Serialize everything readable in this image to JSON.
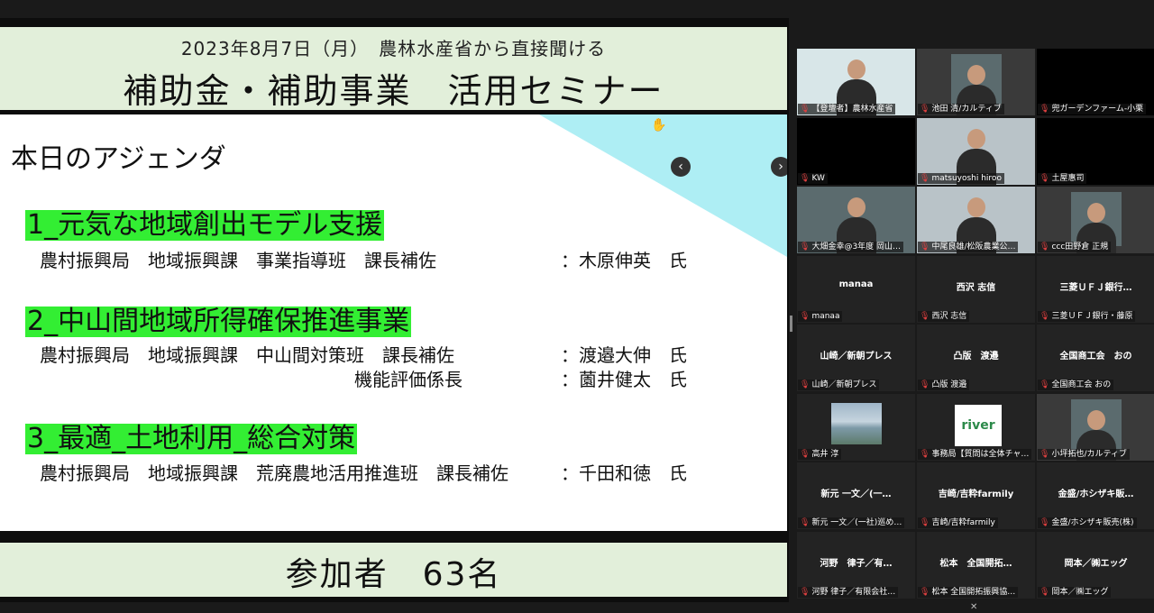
{
  "header": {
    "subtitle": "2023年8月7日（月）　農林水産省から直接聞ける",
    "title": "補助金・補助事業　活用セミナー"
  },
  "slide": {
    "agenda_title": "本日のアジェンダ",
    "items": [
      {
        "heading": "1_元気な地域創出モデル支援",
        "rows": [
          {
            "dept": "農村振興局　地域振興課　事業指導班　課長補佐",
            "person": "：木原伸英　氏"
          }
        ]
      },
      {
        "heading": "2_中山間地域所得確保推進事業",
        "rows": [
          {
            "dept": "農村振興局　地域振興課　中山間対策班　課長補佐",
            "person": "：渡邉大伸　氏"
          },
          {
            "dept": "機能評価係長",
            "person": "：薗井健太　氏"
          }
        ]
      },
      {
        "heading": "3_最適_土地利用_総合対策",
        "rows": [
          {
            "dept": "農村振興局　地域振興課　荒廃農地活用推進班　課長補佐",
            "person": "：千田和徳　氏"
          }
        ]
      }
    ],
    "accent_color": "#33ee33",
    "triangle_color": "#aeeef4"
  },
  "footer": {
    "participants": "参加者　63名"
  },
  "nav": {
    "prev_icon": "chevron-left-icon",
    "next_icon": "chevron-right-icon"
  },
  "gallery": {
    "tiles": [
      {
        "caption": "【登壇者】農林水産省",
        "kind": "video-speaker",
        "active": true
      },
      {
        "caption": "池田 清/カルティブ",
        "kind": "video"
      },
      {
        "caption": "兜ガーデンファーム-小栗",
        "kind": "black"
      },
      {
        "caption": "KW",
        "kind": "black"
      },
      {
        "caption": "matsuyoshi hiroo",
        "kind": "video-room"
      },
      {
        "caption": "土屋惠司",
        "kind": "black"
      },
      {
        "caption": "大畑金幸@3年度  岡山…",
        "kind": "video"
      },
      {
        "caption": "中尾良雄/松阪農業公…",
        "kind": "video-room"
      },
      {
        "caption": "ccc田野倉 正規",
        "kind": "video"
      },
      {
        "caption": "manaa",
        "name": "manaa",
        "kind": "name"
      },
      {
        "caption": "西沢 志信",
        "name": "西沢 志信",
        "kind": "name"
      },
      {
        "caption": "三菱ＵＦＪ銀行・藤原",
        "name": "三菱ＵＦＪ銀行…",
        "kind": "name"
      },
      {
        "caption": "山崎／新朝プレス",
        "name": "山崎／新朝プレス",
        "kind": "name"
      },
      {
        "caption": "凸版 渡邉",
        "name": "凸版　渡邉",
        "kind": "name"
      },
      {
        "caption": "全国商工会 おの",
        "name": "全国商工会　おの",
        "kind": "name"
      },
      {
        "caption": "高井 淳",
        "kind": "photo-landscape"
      },
      {
        "caption": "事務局【質問は全体チャ…",
        "kind": "logo",
        "logo": "river"
      },
      {
        "caption": "小坪拓也/カルティブ",
        "kind": "video"
      },
      {
        "caption": "新元 一文／(一社)巡め…",
        "name": "新元 一文／(一…",
        "kind": "name"
      },
      {
        "caption": "吉崎/吉粋farmily",
        "name": "吉崎/吉粋farmily",
        "kind": "name"
      },
      {
        "caption": "金盛/ホシザキ販売(株)",
        "name": "金盛/ホシザキ販…",
        "kind": "name"
      },
      {
        "caption": "河野 律子／有限会社…",
        "name": "河野　律子／有…",
        "kind": "name"
      },
      {
        "caption": "松本 全国開拓振興協…",
        "name": "松本　全国開拓…",
        "kind": "name"
      },
      {
        "caption": "岡本／㈱エッグ",
        "name": "岡本／㈱エッグ",
        "kind": "name"
      }
    ]
  }
}
